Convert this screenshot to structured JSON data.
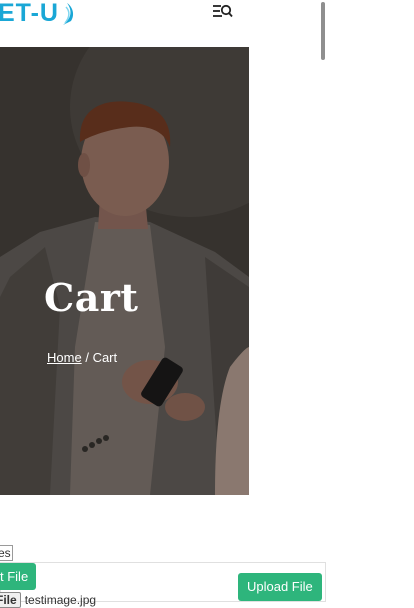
{
  "header": {
    "logo_text": "ET-U",
    "menu_icon": "menu-search-icon",
    "brand_color": "#1aa7d6"
  },
  "hero": {
    "title": "Cart",
    "breadcrumb": {
      "home": "Home",
      "separator": "/",
      "current": "Cart"
    }
  },
  "upload": {
    "files_label": "es",
    "select_label": "t File",
    "choose_label": "e File",
    "file_name": "testimage.jpg",
    "upload_label": "Upload File",
    "button_color": "#2eb57c"
  }
}
